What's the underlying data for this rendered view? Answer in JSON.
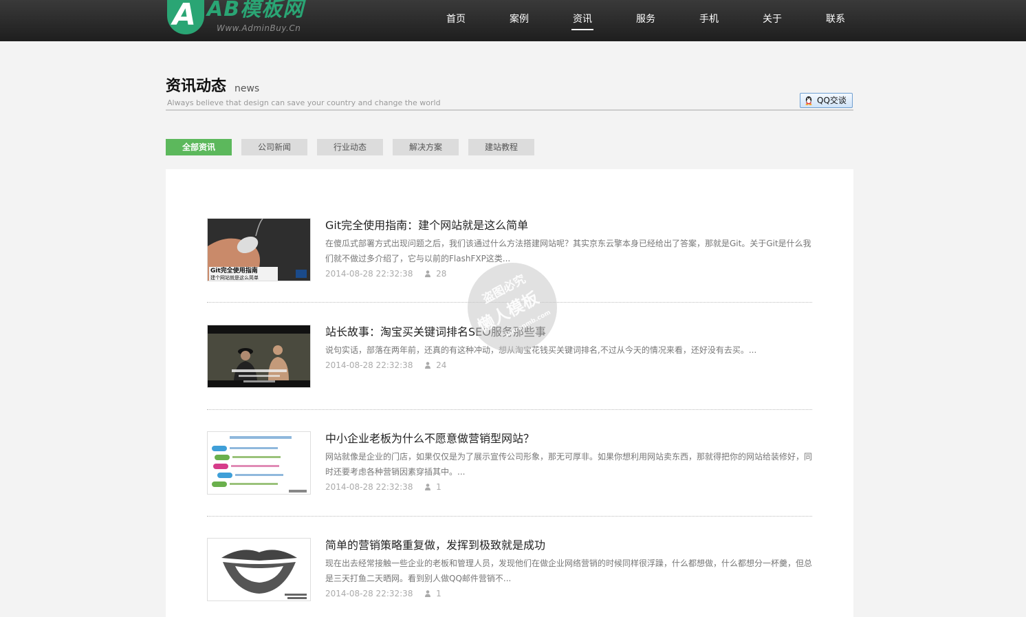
{
  "header": {
    "logo_letter": "A",
    "logo_text": "AB模板网",
    "logo_sub": "Www.AdminBuy.Cn",
    "nav": [
      {
        "label": "首页"
      },
      {
        "label": "案例"
      },
      {
        "label": "资讯"
      },
      {
        "label": "服务"
      },
      {
        "label": "手机"
      },
      {
        "label": "关于"
      },
      {
        "label": "联系"
      }
    ],
    "active_nav": "资讯"
  },
  "section": {
    "title": "资讯动态",
    "title_en": "news",
    "slogan": "Always believe that design can save your country and change the world",
    "qq_label": "QQ交谈"
  },
  "tabs": [
    {
      "label": "全部资讯",
      "active": true
    },
    {
      "label": "公司新闻",
      "active": false
    },
    {
      "label": "行业动态",
      "active": false
    },
    {
      "label": "解决方案",
      "active": false
    },
    {
      "label": "建站教程",
      "active": false
    }
  ],
  "articles": [
    {
      "title": "Git完全使用指南：建个网站就是这么简单",
      "desc": "在傻瓜式部署方式出现问题之后，我们该通过什么方法搭建网站呢？其实京东云擎本身已经给出了答案，那就是Git。关于Git是什么我们就不做过多介绍了，它与以前的FlashFXP这类...",
      "date": "2014-08-28 22:32:38",
      "views": "28",
      "thumb_caption_1": "Git完全使用指南",
      "thumb_caption_2": "建个网站就是这么简单"
    },
    {
      "title": "站长故事：淘宝买关键词排名SEO服务那些事",
      "desc": "说句实话，部落在两年前，还真的有这种冲动，想从淘宝花钱买关键词排名,不过从今天的情况来看，还好没有去买。...",
      "date": "2014-08-28 22:32:38",
      "views": "24"
    },
    {
      "title": "中小企业老板为什么不愿意做营销型网站？",
      "desc": "网站就像是企业的门店，如果仅仅是为了展示宣传公司形象，那无可厚非。如果你想利用网站卖东西，那就得把你的网站给装修好，同时还要考虑各种营销因素穿插其中。...",
      "date": "2014-08-28 22:32:38",
      "views": "1"
    },
    {
      "title": "简单的营销策略重复做，发挥到极致就是成功",
      "desc": "现在出去经常接触一些企业的老板和管理人员，发现他们在做企业网络营销的时候同样很浮躁，什么都想做，什么都想分一杯羹，但总是三天打鱼二天晒网。看到别人做QQ邮件营销不...",
      "date": "2014-08-28 22:32:38",
      "views": "1"
    }
  ],
  "watermark": {
    "line1": "盗图必究",
    "line2": "懒人模板",
    "line3": "lanrenmb.com"
  },
  "colors": {
    "accent_green": "#5cb85c",
    "logo_green": "#2aa574",
    "header_dark": "#2a2a2a"
  }
}
